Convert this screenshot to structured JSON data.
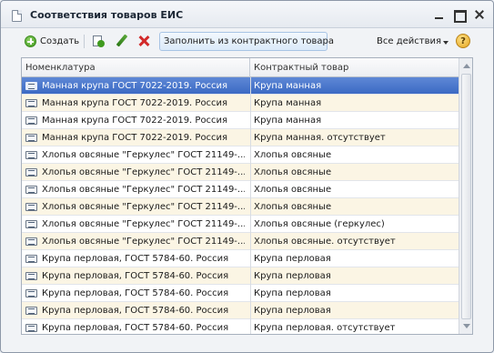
{
  "window": {
    "title": "Соответствия товаров ЕИС"
  },
  "toolbar": {
    "create_label": "Создать",
    "fill_label": "Заполнить из контрактного товара",
    "actions_label": "Все действия",
    "help_label": "?"
  },
  "table": {
    "columns": [
      "Номенклатура",
      "Контрактный товар"
    ],
    "rows": [
      {
        "nomenclature": "Манная крупа ГОСТ 7022-2019. Россия",
        "contract_item": "Крупа манная"
      },
      {
        "nomenclature": "Манная крупа ГОСТ 7022-2019. Россия",
        "contract_item": "Крупа манная"
      },
      {
        "nomenclature": "Манная крупа ГОСТ 7022-2019. Россия",
        "contract_item": "Крупа манная"
      },
      {
        "nomenclature": "Манная крупа ГОСТ 7022-2019. Россия",
        "contract_item": "Крупа манная. отсутствует"
      },
      {
        "nomenclature": "Хлопья овсяные \"Геркулес\" ГОСТ 21149-...",
        "contract_item": "Хлопья овсяные"
      },
      {
        "nomenclature": "Хлопья овсяные \"Геркулес\" ГОСТ 21149-...",
        "contract_item": "Хлопья овсяные"
      },
      {
        "nomenclature": "Хлопья овсяные \"Геркулес\" ГОСТ 21149-...",
        "contract_item": "Хлопья овсяные"
      },
      {
        "nomenclature": "Хлопья овсяные \"Геркулес\" ГОСТ 21149-...",
        "contract_item": "Хлопья овсяные"
      },
      {
        "nomenclature": "Хлопья овсяные \"Геркулес\" ГОСТ 21149-...",
        "contract_item": "Хлопья овсяные (геркулес)"
      },
      {
        "nomenclature": "Хлопья овсяные \"Геркулес\" ГОСТ 21149-...",
        "contract_item": "Хлопья овсяные. отсутствует"
      },
      {
        "nomenclature": "Крупа перловая, ГОСТ 5784-60. Россия",
        "contract_item": "Крупа перловая"
      },
      {
        "nomenclature": "Крупа перловая, ГОСТ 5784-60. Россия",
        "contract_item": "Крупа перловая"
      },
      {
        "nomenclature": "Крупа перловая, ГОСТ 5784-60. Россия",
        "contract_item": "Крупа перловая"
      },
      {
        "nomenclature": "Крупа перловая, ГОСТ 5784-60. Россия",
        "contract_item": "Крупа перловая"
      },
      {
        "nomenclature": "Крупа перловая, ГОСТ 5784-60. Россия",
        "contract_item": "Крупа перловая. отсутствует"
      }
    ]
  }
}
